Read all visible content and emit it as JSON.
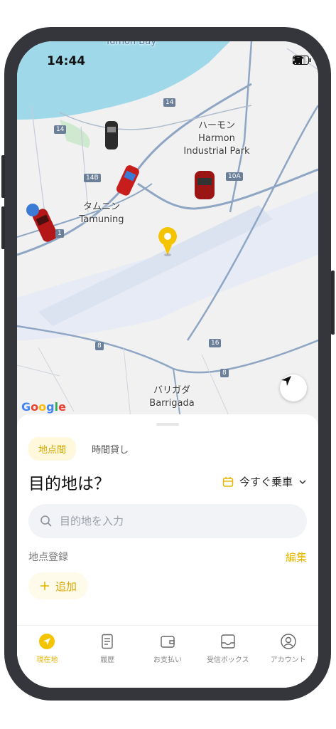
{
  "status_bar": {
    "time": "14:44"
  },
  "map": {
    "labels": {
      "harmon_jp": "ハーモン",
      "harmon_en": "Harmon",
      "harmon_sub": "Industrial Park",
      "tamuning_jp": "タムニン",
      "tamuning_en": "Tamuning",
      "barrigada_jp": "バリガダ",
      "barrigada_en": "Barrigada",
      "bay_partial": "Tumon Bay"
    },
    "route_shields": [
      "14",
      "14",
      "14B",
      "10A",
      "8",
      "16",
      "8",
      "1"
    ],
    "attribution": "Google"
  },
  "sheet": {
    "tabs": [
      {
        "label": "地点間",
        "active": true
      },
      {
        "label": "時間貸し",
        "active": false
      }
    ],
    "question": "目的地は？",
    "ride_time": "今すぐ乗車",
    "search": {
      "placeholder": "目的地を入力"
    },
    "saved_places_label": "地点登録",
    "edit_label": "編集",
    "add_label": "追加"
  },
  "tab_bar": [
    {
      "label": "現在地",
      "icon": "location-icon",
      "active": true
    },
    {
      "label": "履歴",
      "icon": "history-icon",
      "active": false
    },
    {
      "label": "お支払い",
      "icon": "wallet-icon",
      "active": false
    },
    {
      "label": "受信ボックス",
      "icon": "inbox-icon",
      "active": false
    },
    {
      "label": "アカウント",
      "icon": "account-icon",
      "active": false
    }
  ],
  "colors": {
    "accent": "#F5C400",
    "water": "#9fd9e9",
    "airport": "#e6ebf5",
    "road": "#8ea6c4"
  }
}
